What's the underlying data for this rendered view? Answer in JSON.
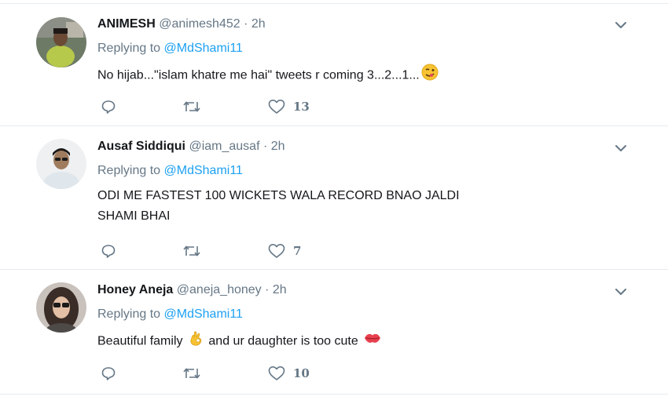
{
  "tweets": [
    {
      "name": "ANIMESH",
      "handle": "@animesh452",
      "separator": "·",
      "time": "2h",
      "replying_prefix": "Replying to",
      "replying_to": "@MdShami11",
      "text": "No hijab...\"islam khatre me hai\" tweets r coming 3...2...1...",
      "text_emoji": "winking-face-emoji",
      "likes": "13"
    },
    {
      "name": "Ausaf Siddiqui",
      "handle": "@iam_ausaf",
      "separator": "·",
      "time": "2h",
      "replying_prefix": "Replying to",
      "replying_to": "@MdShami11",
      "text_line1": "ODI ME FASTEST 100 WICKETS WALA RECORD BNAO JALDI",
      "text_line2": "SHAMI BHAI",
      "likes": "7"
    },
    {
      "name": "Honey Aneja",
      "handle": "@aneja_honey",
      "separator": "·",
      "time": "2h",
      "replying_prefix": "Replying to",
      "replying_to": "@MdShami11",
      "text_part1": "Beautiful family",
      "text_part2": "and ur daughter is too cute",
      "emoji_1": "ok-hand-emoji",
      "emoji_2": "kiss-mark-emoji",
      "likes": "10"
    }
  ],
  "icons": {
    "reply": "reply-icon",
    "retweet": "retweet-icon",
    "like": "heart-icon",
    "menu": "chevron-down-icon"
  },
  "colors": {
    "link": "#1da1f2",
    "muted": "#657786",
    "text": "#14171a",
    "divider": "#e6ecf0"
  }
}
